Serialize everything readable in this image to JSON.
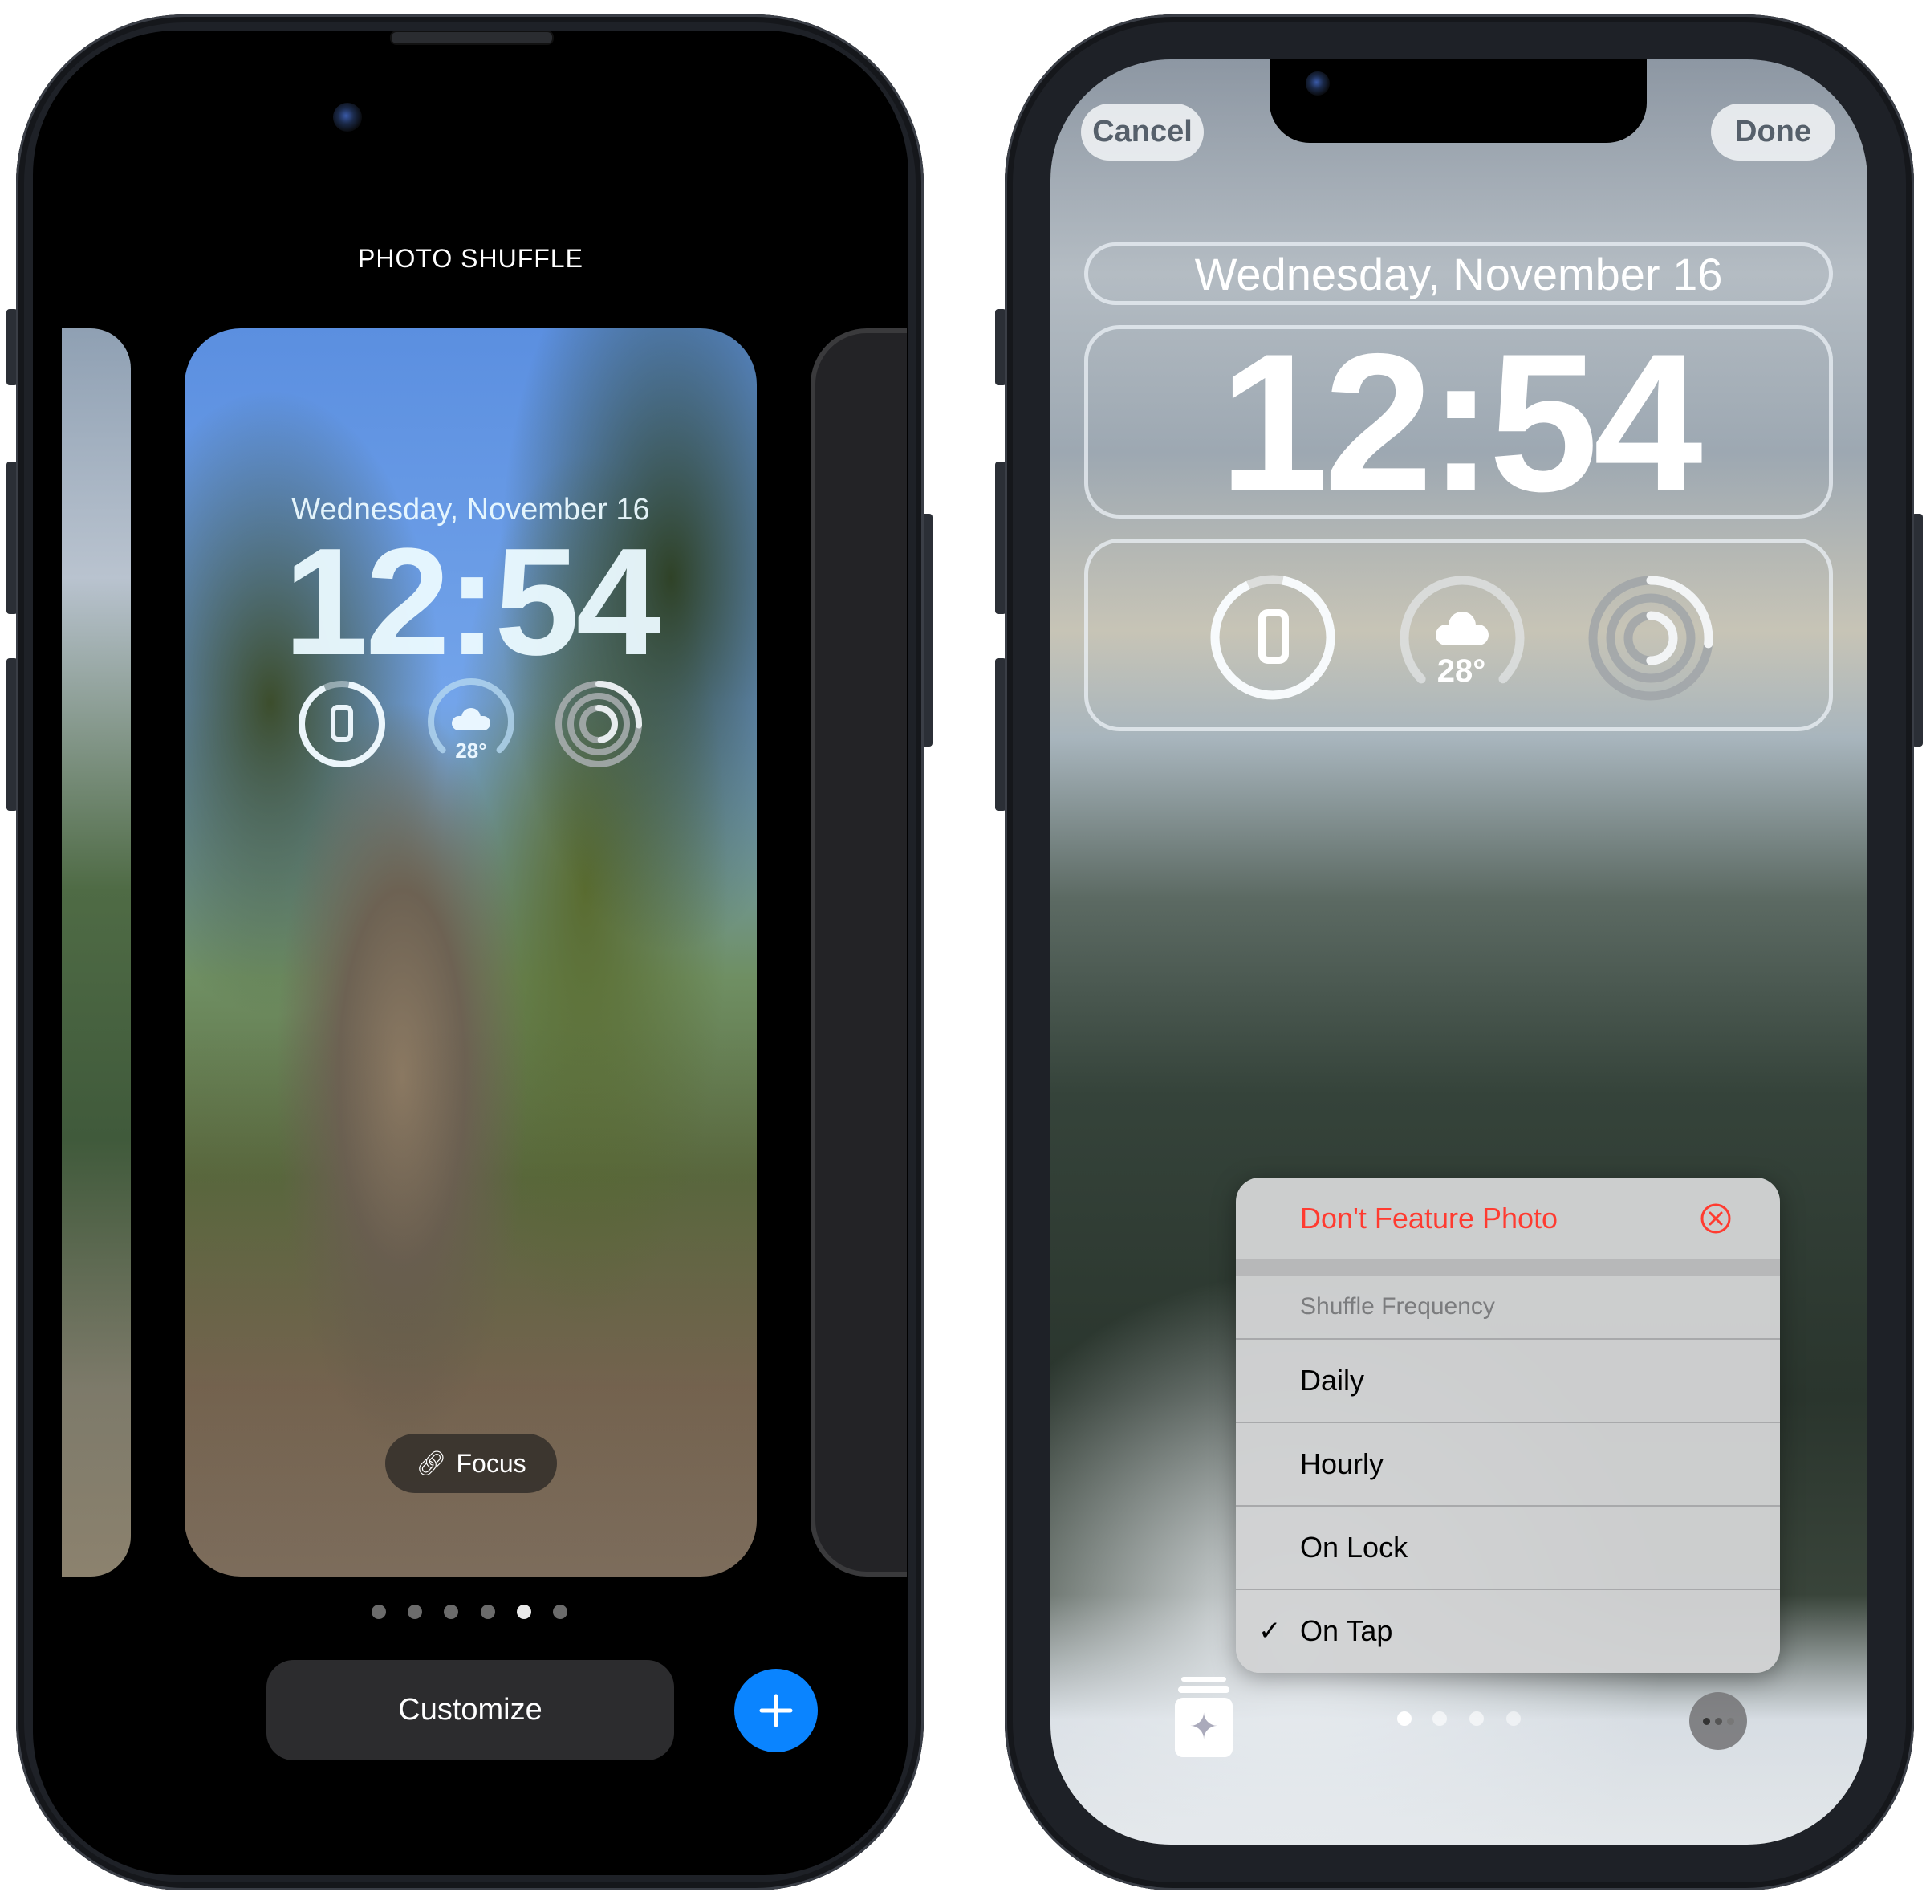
{
  "left_phone": {
    "header": "PHOTO SHUFFLE",
    "lock_screen": {
      "date": "Wednesday, November 16",
      "time": "12:54",
      "widgets": [
        {
          "name": "watch-battery",
          "icon": "watch-icon",
          "ring_fraction": 0.9
        },
        {
          "name": "weather",
          "icon": "cloud-icon",
          "value": "28°",
          "ring_fraction": 0.75
        },
        {
          "name": "activity",
          "icon": "activity-rings-icon",
          "ring_fraction": 0.35
        }
      ]
    },
    "focus_button": {
      "icon": "link-icon",
      "label": "Focus"
    },
    "page_dots": {
      "count": 6,
      "active_index": 4
    },
    "customize_button": "Customize",
    "add_button": {
      "icon": "plus-icon",
      "color": "#0a84ff"
    }
  },
  "right_phone": {
    "cancel_button": "Cancel",
    "done_button": "Done",
    "lock_screen": {
      "date": "Wednesday, November 16",
      "time": "12:54",
      "widgets": [
        {
          "name": "watch-battery",
          "icon": "watch-icon",
          "ring_fraction": 0.9
        },
        {
          "name": "weather",
          "icon": "cloud-icon",
          "value": "28°",
          "ring_fraction": 0.75
        },
        {
          "name": "activity",
          "icon": "activity-rings-icon",
          "ring_fraction": 0.35
        }
      ]
    },
    "context_menu": {
      "destructive_item": {
        "label": "Don't Feature Photo",
        "icon": "xmark-circle-icon",
        "color": "#ff3b30"
      },
      "section_header": "Shuffle Frequency",
      "items": [
        {
          "label": "Daily",
          "checked": false
        },
        {
          "label": "Hourly",
          "checked": false
        },
        {
          "label": "On Lock",
          "checked": false
        },
        {
          "label": "On Tap",
          "checked": true
        }
      ],
      "check_glyph": "✓"
    },
    "bottom_bar": {
      "left_icon": "photo-library-sparkle-icon",
      "page_dots": {
        "count": 4,
        "active_index": 0
      },
      "right_icon": "more-options-icon"
    }
  }
}
